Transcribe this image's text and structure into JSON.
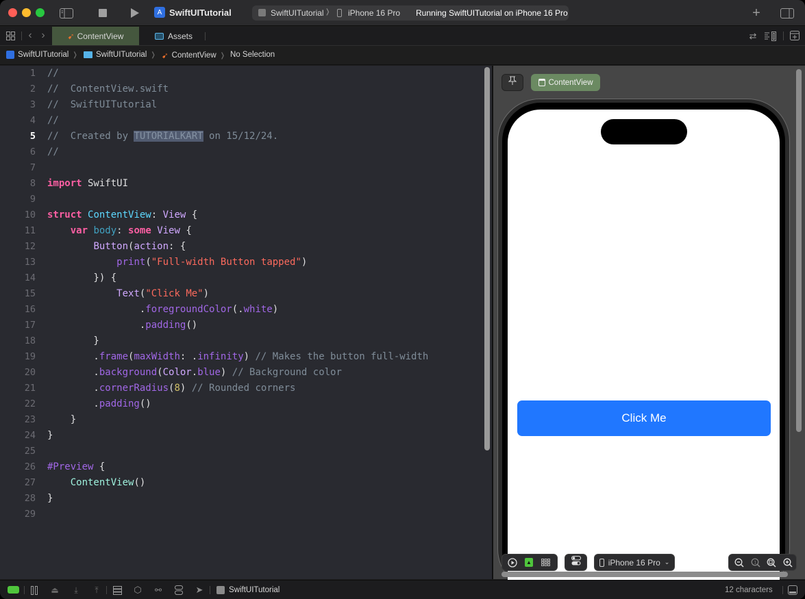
{
  "titlebar": {
    "app_title": "SwiftUITutorial",
    "scheme": "SwiftUITutorial",
    "destination": "iPhone 16 Pro",
    "status": "Running SwiftUITutorial on iPhone 16 Pro",
    "icons": [
      "sidebar-toggle-icon",
      "stop-icon",
      "run-icon",
      "app-icon",
      "add-icon",
      "inspector-toggle-icon"
    ]
  },
  "tabs": [
    {
      "label": "ContentView",
      "icon": "swift-icon",
      "active": true
    },
    {
      "label": "Assets",
      "icon": "assets-icon",
      "active": false
    }
  ],
  "jumpbar": {
    "crumbs": [
      {
        "label": "SwiftUITutorial",
        "icon": "app-icon"
      },
      {
        "label": "SwiftUITutorial",
        "icon": "folder-icon"
      },
      {
        "label": "ContentView",
        "icon": "swift-icon"
      },
      {
        "label": "No Selection",
        "icon": ""
      }
    ]
  },
  "editor": {
    "current_line": 5,
    "line_numbers": [
      "1",
      "2",
      "3",
      "4",
      "5",
      "6",
      "7",
      "8",
      "9",
      "10",
      "11",
      "12",
      "13",
      "14",
      "15",
      "16",
      "17",
      "18",
      "19",
      "20",
      "21",
      "22",
      "23",
      "24",
      "25",
      "26",
      "27",
      "28",
      "29"
    ],
    "lines": [
      [
        {
          "t": "//",
          "c": "comment"
        }
      ],
      [
        {
          "t": "//  ContentView.swift",
          "c": "comment"
        }
      ],
      [
        {
          "t": "//  SwiftUITutorial",
          "c": "comment"
        }
      ],
      [
        {
          "t": "//",
          "c": "comment"
        }
      ],
      [
        {
          "t": "//  Created by ",
          "c": "comment"
        },
        {
          "t": "TUTORIALKART",
          "c": "highlight"
        },
        {
          "t": " on 15/12/24.",
          "c": "comment"
        }
      ],
      [
        {
          "t": "//",
          "c": "comment"
        }
      ],
      [],
      [
        {
          "t": "import",
          "c": "kw"
        },
        {
          "t": " SwiftUI",
          "c": "plain"
        }
      ],
      [],
      [
        {
          "t": "struct",
          "c": "kw"
        },
        {
          "t": " ",
          "c": "plain"
        },
        {
          "t": "ContentView",
          "c": "decl"
        },
        {
          "t": ": ",
          "c": "plain"
        },
        {
          "t": "View",
          "c": "type"
        },
        {
          "t": " {",
          "c": "plain"
        }
      ],
      [
        {
          "t": "    ",
          "c": "plain"
        },
        {
          "t": "var",
          "c": "kw"
        },
        {
          "t": " ",
          "c": "plain"
        },
        {
          "t": "body",
          "c": "prop"
        },
        {
          "t": ": ",
          "c": "plain"
        },
        {
          "t": "some",
          "c": "kw"
        },
        {
          "t": " ",
          "c": "plain"
        },
        {
          "t": "View",
          "c": "type"
        },
        {
          "t": " {",
          "c": "plain"
        }
      ],
      [
        {
          "t": "        ",
          "c": "plain"
        },
        {
          "t": "Button",
          "c": "type"
        },
        {
          "t": "(",
          "c": "plain"
        },
        {
          "t": "action",
          "c": "type"
        },
        {
          "t": ": {",
          "c": "plain"
        }
      ],
      [
        {
          "t": "            ",
          "c": "plain"
        },
        {
          "t": "print",
          "c": "method"
        },
        {
          "t": "(",
          "c": "plain"
        },
        {
          "t": "\"Full-width Button tapped\"",
          "c": "str"
        },
        {
          "t": ")",
          "c": "plain"
        }
      ],
      [
        {
          "t": "        }) {",
          "c": "plain"
        }
      ],
      [
        {
          "t": "            ",
          "c": "plain"
        },
        {
          "t": "Text",
          "c": "type"
        },
        {
          "t": "(",
          "c": "plain"
        },
        {
          "t": "\"Click Me\"",
          "c": "str"
        },
        {
          "t": ")",
          "c": "plain"
        }
      ],
      [
        {
          "t": "                .",
          "c": "plain"
        },
        {
          "t": "foregroundColor",
          "c": "method"
        },
        {
          "t": "(.",
          "c": "plain"
        },
        {
          "t": "white",
          "c": "method"
        },
        {
          "t": ")",
          "c": "plain"
        }
      ],
      [
        {
          "t": "                .",
          "c": "plain"
        },
        {
          "t": "padding",
          "c": "method"
        },
        {
          "t": "()",
          "c": "plain"
        }
      ],
      [
        {
          "t": "        }",
          "c": "plain"
        }
      ],
      [
        {
          "t": "        .",
          "c": "plain"
        },
        {
          "t": "frame",
          "c": "method"
        },
        {
          "t": "(",
          "c": "plain"
        },
        {
          "t": "maxWidth",
          "c": "method"
        },
        {
          "t": ": .",
          "c": "plain"
        },
        {
          "t": "infinity",
          "c": "method"
        },
        {
          "t": ") ",
          "c": "plain"
        },
        {
          "t": "// Makes the button full-width",
          "c": "comment"
        }
      ],
      [
        {
          "t": "        .",
          "c": "plain"
        },
        {
          "t": "background",
          "c": "method"
        },
        {
          "t": "(",
          "c": "plain"
        },
        {
          "t": "Color",
          "c": "type"
        },
        {
          "t": ".",
          "c": "plain"
        },
        {
          "t": "blue",
          "c": "method"
        },
        {
          "t": ") ",
          "c": "plain"
        },
        {
          "t": "// Background color",
          "c": "comment"
        }
      ],
      [
        {
          "t": "        .",
          "c": "plain"
        },
        {
          "t": "cornerRadius",
          "c": "method"
        },
        {
          "t": "(",
          "c": "plain"
        },
        {
          "t": "8",
          "c": "num"
        },
        {
          "t": ") ",
          "c": "plain"
        },
        {
          "t": "// Rounded corners",
          "c": "comment"
        }
      ],
      [
        {
          "t": "        .",
          "c": "plain"
        },
        {
          "t": "padding",
          "c": "method"
        },
        {
          "t": "()",
          "c": "plain"
        }
      ],
      [
        {
          "t": "    }",
          "c": "plain"
        }
      ],
      [
        {
          "t": "}",
          "c": "plain"
        }
      ],
      [],
      [
        {
          "t": "#Preview",
          "c": "method"
        },
        {
          "t": " {",
          "c": "plain"
        }
      ],
      [
        {
          "t": "    ",
          "c": "plain"
        },
        {
          "t": "ContentView",
          "c": "class"
        },
        {
          "t": "()",
          "c": "plain"
        }
      ],
      [
        {
          "t": "}",
          "c": "plain"
        }
      ],
      []
    ]
  },
  "preview": {
    "pin_icon": "pin-icon",
    "view_label": "ContentView",
    "button_label": "Click Me",
    "button_color": "#2077ff",
    "device_label": "iPhone 16 Pro",
    "controls": [
      "live-preview-icon",
      "selectable-mode-icon",
      "variants-icon",
      "device-settings-icon"
    ],
    "zoom_controls": [
      "zoom-out-icon",
      "zoom-actual-size-icon",
      "zoom-to-fit-icon",
      "zoom-in-icon"
    ]
  },
  "statusbar": {
    "target": "SwiftUITutorial",
    "characters": "12 characters",
    "accent_green": "#4fc53c"
  },
  "colors": {
    "tab_active_bg": "#45573e",
    "preview_badge_bg": "#6b8a62",
    "editor_bg": "#292a30"
  }
}
